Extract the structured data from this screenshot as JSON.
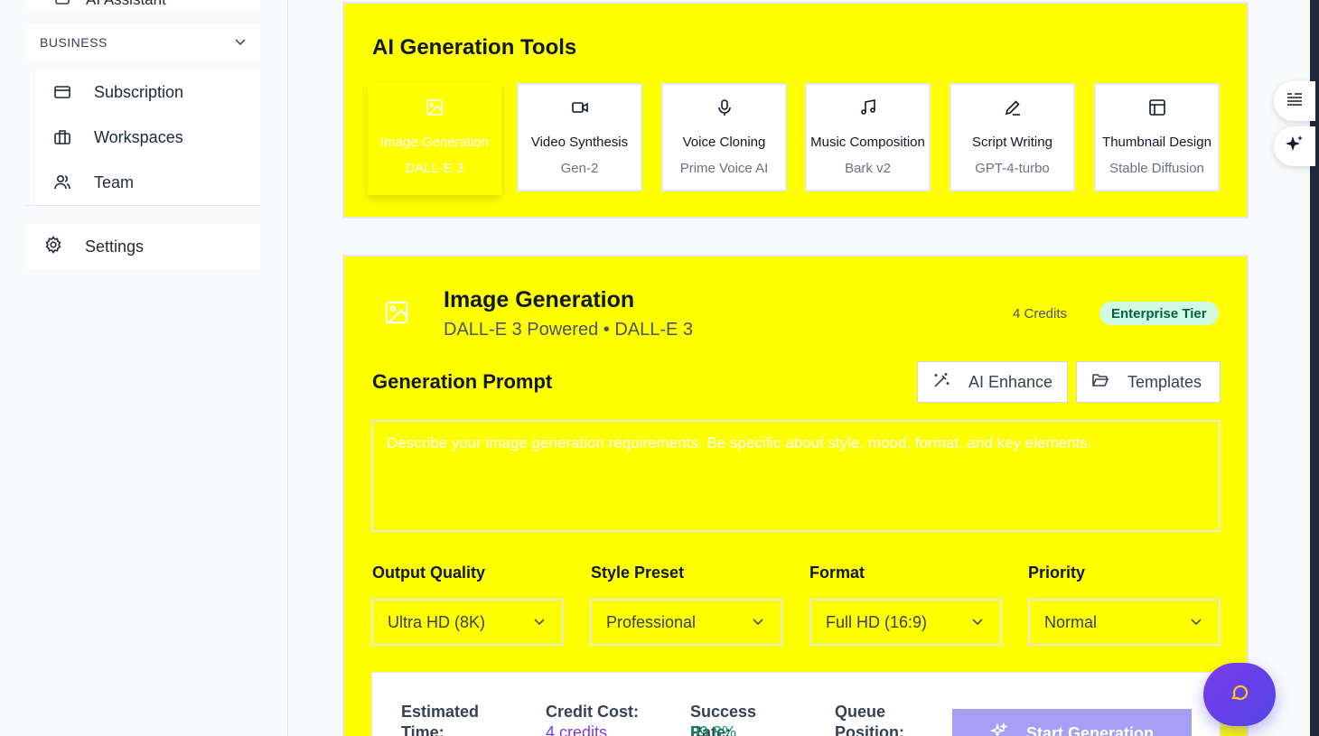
{
  "sidebar": {
    "top_item_label": "AI Assistant",
    "section_label": "BUSINESS",
    "items": [
      {
        "label": "Subscription",
        "icon": "credit-card-icon"
      },
      {
        "label": "Workspaces",
        "icon": "briefcase-icon"
      },
      {
        "label": "Team",
        "icon": "users-icon"
      }
    ],
    "settings_label": "Settings"
  },
  "tools": {
    "title": "AI Generation Tools",
    "items": [
      {
        "name": "Image Generation",
        "model": "DALL-E 3",
        "icon": "image-icon",
        "active": true
      },
      {
        "name": "Video Synthesis",
        "model": "Gen-2",
        "icon": "video-icon"
      },
      {
        "name": "Voice Cloning",
        "model": "Prime Voice AI",
        "icon": "microphone-icon"
      },
      {
        "name": "Music Composition",
        "model": "Bark v2",
        "icon": "music-icon"
      },
      {
        "name": "Script Writing",
        "model": "GPT-4-turbo",
        "icon": "pen-icon"
      },
      {
        "name": "Thumbnail Design",
        "model": "Stable Diffusion",
        "icon": "layout-icon"
      }
    ]
  },
  "generator": {
    "title": "Image Generation",
    "subtitle": "DALL-E 3 Powered • DALL-E 3",
    "credits": "4 Credits",
    "tier": "Enterprise Tier",
    "prompt_label": "Generation Prompt",
    "enhance_label": "AI Enhance",
    "templates_label": "Templates",
    "prompt_placeholder": "Describe your image generation requirements. Be specific about style, mood, format, and key elements.",
    "fields": [
      {
        "label": "Output Quality",
        "value": "Ultra HD (8K)"
      },
      {
        "label": "Style Preset",
        "value": "Professional"
      },
      {
        "label": "Format",
        "value": "Full HD (16:9)"
      },
      {
        "label": "Priority",
        "value": "Normal"
      }
    ],
    "stats": [
      {
        "label": "Estimated Time:",
        "value": ""
      },
      {
        "label": "Credit Cost:",
        "value": "4 credits"
      },
      {
        "label": "Success Rate:",
        "value": "99.8%"
      },
      {
        "label": "Queue Position:",
        "value": ""
      }
    ],
    "start_label": "Start Generation"
  },
  "colors": {
    "card_bg": "#ffff00",
    "credit_value": "#7c3aed",
    "success_value": "#059669",
    "start_button": "#a5a0f5"
  }
}
